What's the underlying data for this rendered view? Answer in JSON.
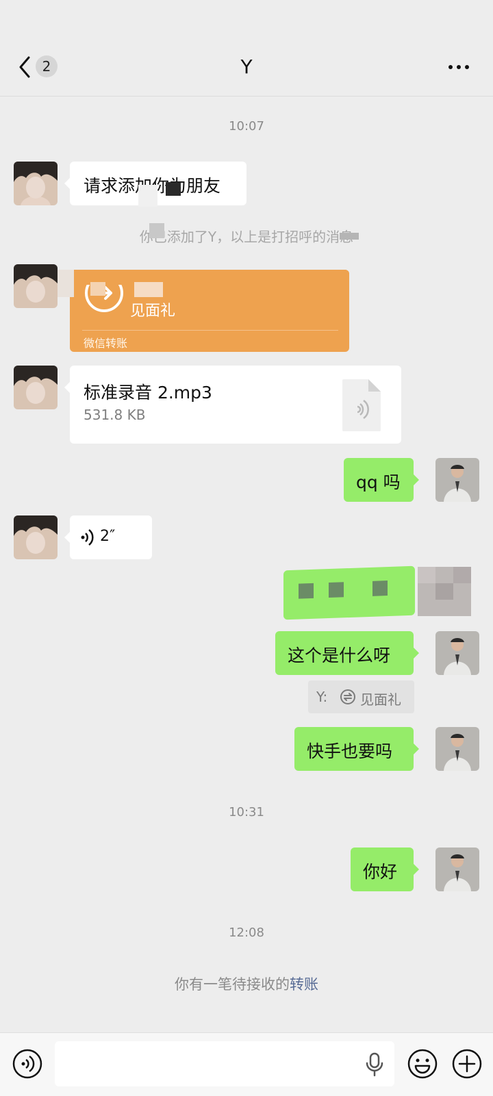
{
  "header": {
    "unread_count": "2",
    "title": "Y"
  },
  "timestamps": {
    "t1": "10:07",
    "t2": "10:31",
    "t3": "12:08"
  },
  "messages": {
    "friend_request": "请求添加你为朋友",
    "system_notice": "你已添加了Y，以上是打招呼的消息",
    "transfer": {
      "title": "见面礼",
      "footer": "微信转账"
    },
    "file": {
      "name": "标准录音 2.mp3",
      "size": "531.8 KB"
    },
    "me_qq": "qq 吗",
    "voice_duration": "2″",
    "me_what": "这个是什么呀",
    "quote": {
      "prefix": "Y:",
      "text": "见面礼"
    },
    "me_kuaishou": "快手也要吗",
    "me_hello": "你好"
  },
  "pending": {
    "text": "你有一笔待接收的",
    "link": "转账"
  },
  "colors": {
    "bubble_green": "#95ec69",
    "transfer_orange": "#eea24f",
    "link": "#576b95"
  }
}
